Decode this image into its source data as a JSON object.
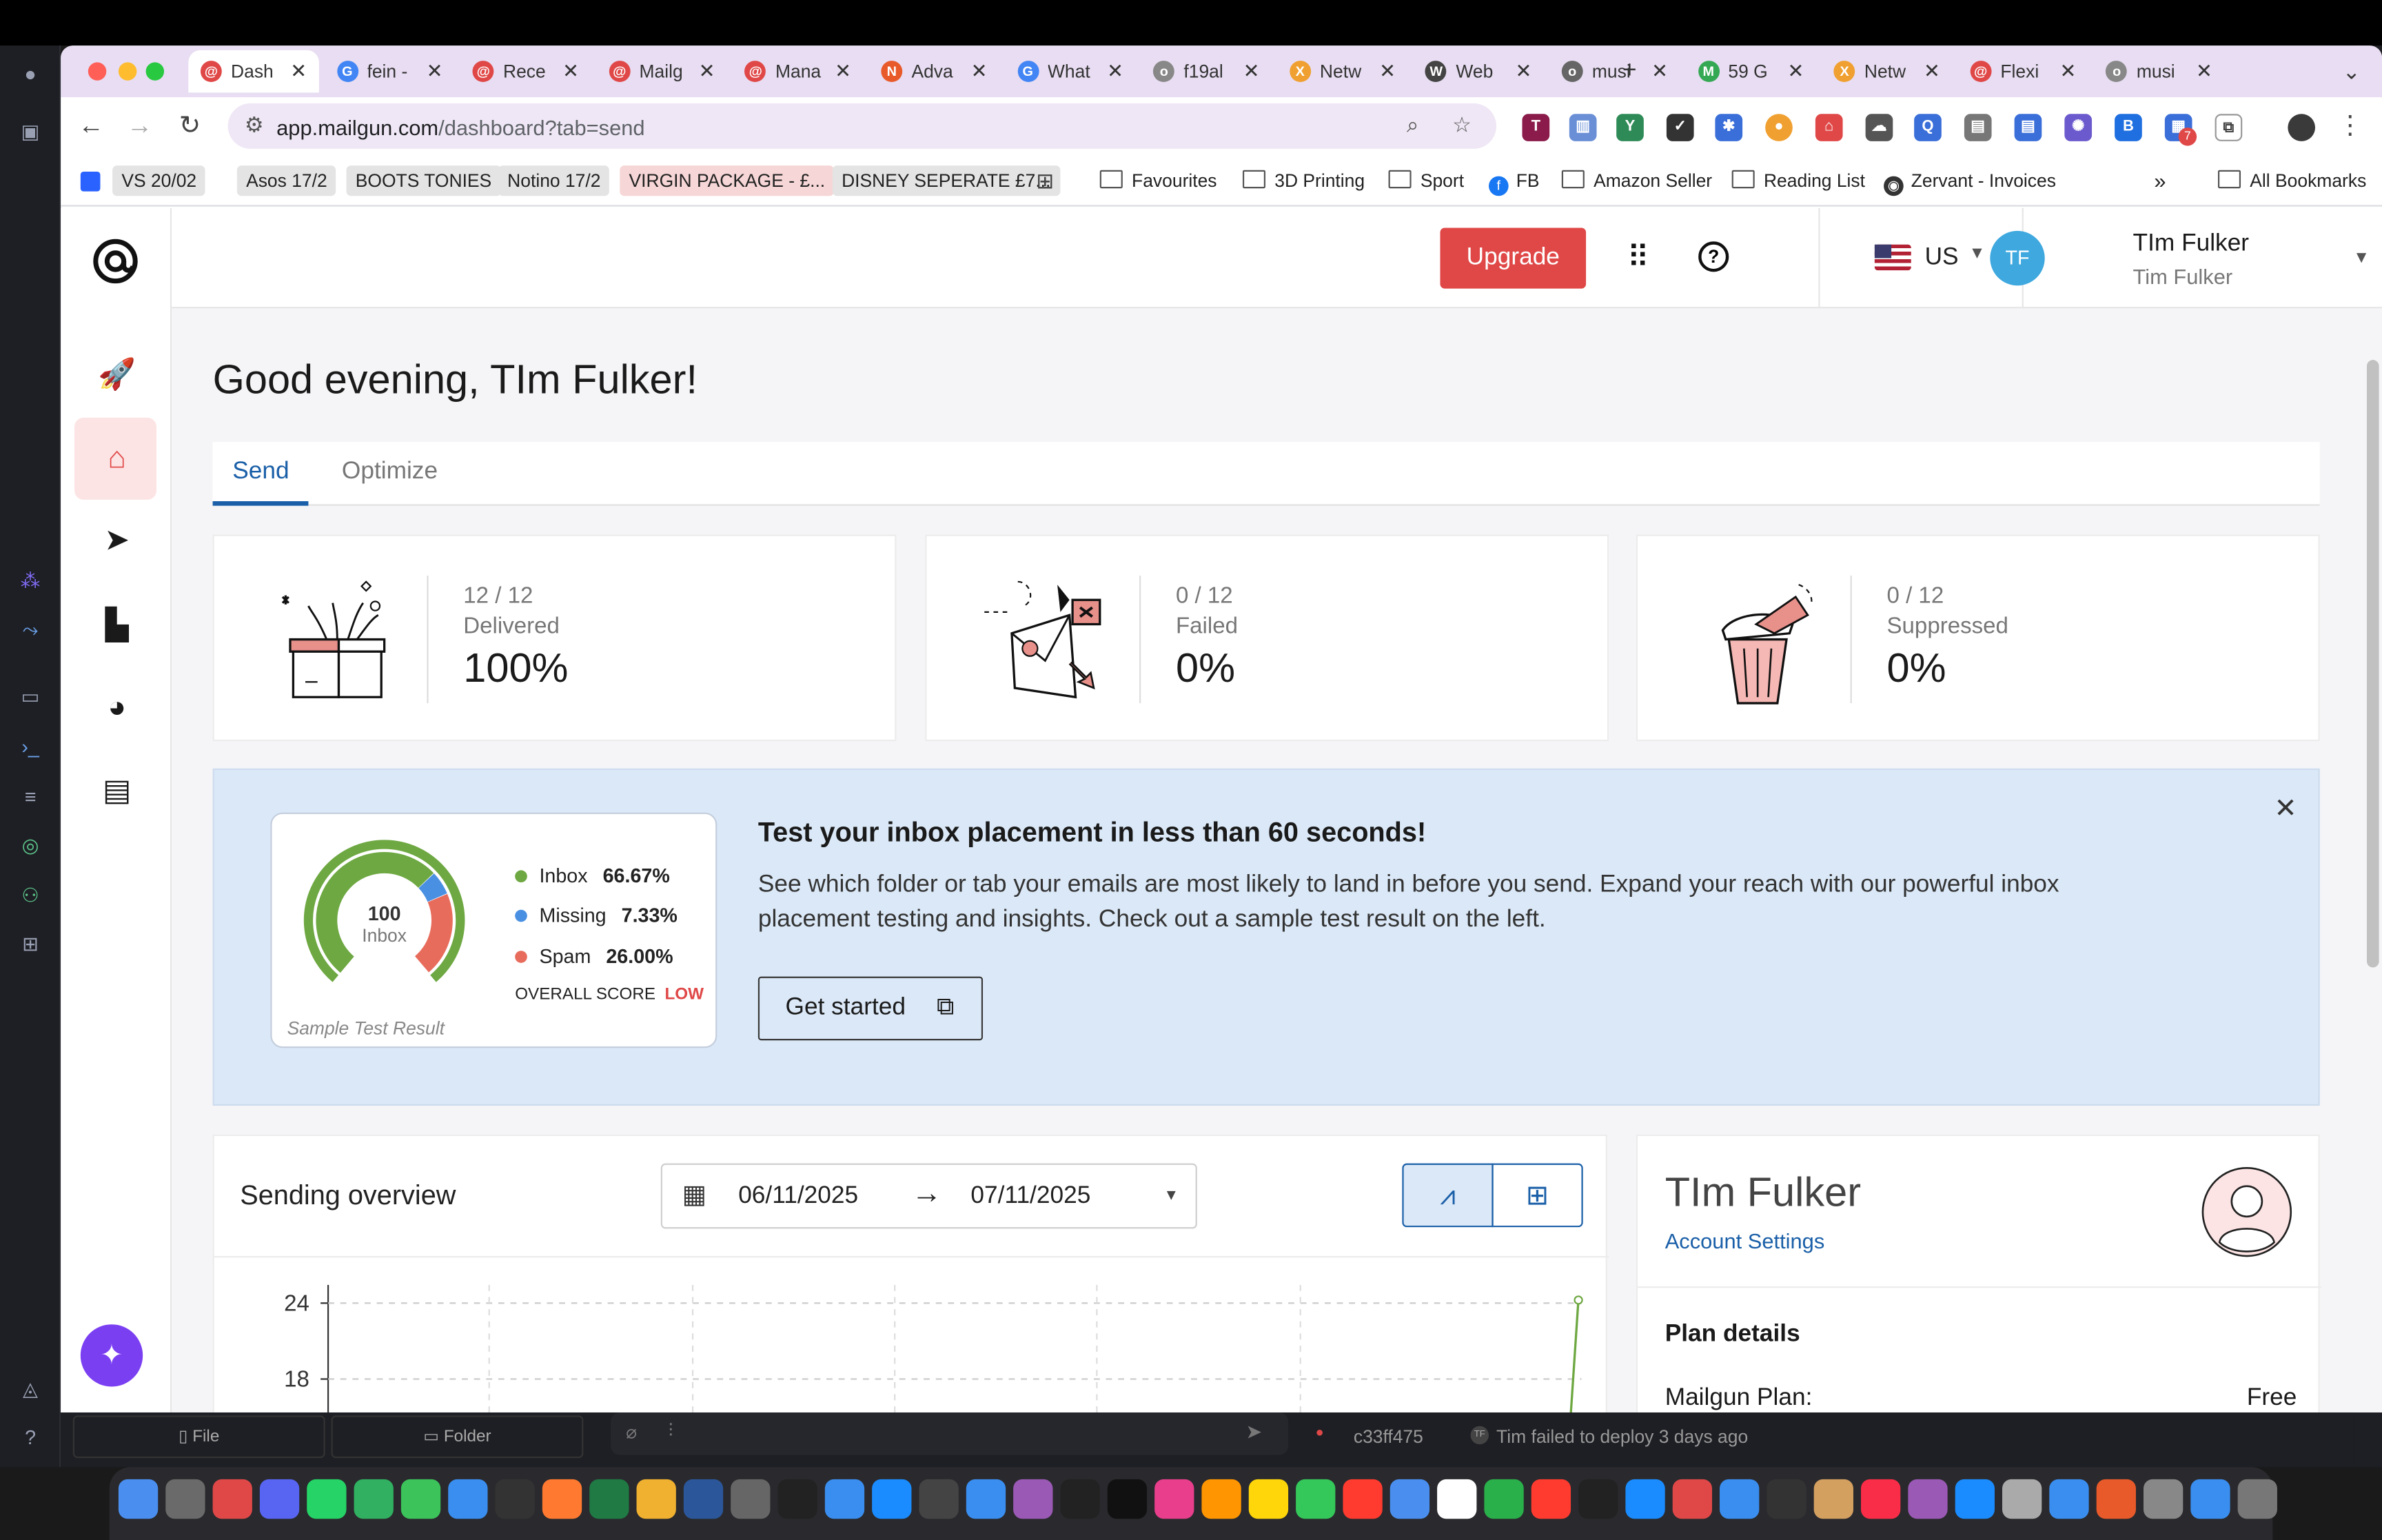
{
  "browser": {
    "tabs": [
      {
        "label": "Dash",
        "active": true,
        "color": "#e04848",
        "glyph": "@"
      },
      {
        "label": "fein -",
        "color": "#4285f4",
        "glyph": "G"
      },
      {
        "label": "Rece",
        "color": "#e04848",
        "glyph": "@"
      },
      {
        "label": "Mailg",
        "color": "#e04848",
        "glyph": "@"
      },
      {
        "label": "Mana",
        "color": "#e04848",
        "glyph": "@"
      },
      {
        "label": "Adva",
        "color": "#e85a2a",
        "glyph": "N"
      },
      {
        "label": "What",
        "color": "#4285f4",
        "glyph": "G"
      },
      {
        "label": "f19al",
        "color": "#888888",
        "glyph": "o"
      },
      {
        "label": "Netw",
        "color": "#f0a030",
        "glyph": "X"
      },
      {
        "label": "Web",
        "color": "#444444",
        "glyph": "W"
      },
      {
        "label": "musi",
        "color": "#666666",
        "glyph": "o"
      },
      {
        "label": "59 G",
        "color": "#34a853",
        "glyph": "M"
      },
      {
        "label": "Netw",
        "color": "#f0a030",
        "glyph": "X"
      },
      {
        "label": "Flexi",
        "color": "#e04848",
        "glyph": "@"
      },
      {
        "label": "musi",
        "color": "#888888",
        "glyph": "o"
      }
    ],
    "new_tab": "+",
    "url_host": "app.mailgun.com",
    "url_path": "/dashboard?tab=send",
    "bookmarks": [
      {
        "label": "VS 20/02",
        "bg": "#e4e4e4"
      },
      {
        "label": "Asos 17/2",
        "bg": "#e4e4e4"
      },
      {
        "label": "BOOTS TONIES",
        "bg": "#e4e4e4"
      },
      {
        "label": "Notino 17/2",
        "bg": "#e4e4e4"
      },
      {
        "label": "VIRGIN PACKAGE - £...",
        "bg": "#f6d6d6"
      },
      {
        "label": "DISNEY SEPERATE £7...",
        "bg": "#e4e4e4"
      }
    ],
    "bookmark_folders": [
      "Favourites",
      "3D Printing",
      "Sport"
    ],
    "bookmark_links": [
      "FB",
      "Amazon Seller",
      "Reading List",
      "Zervant - Invoices"
    ],
    "more": "»",
    "all_bookmarks": "All Bookmarks",
    "extension_badge": "7"
  },
  "header": {
    "upgrade": "Upgrade",
    "region": "US",
    "user_name": "TIm Fulker",
    "user_sub": "Tim Fulker",
    "avatar": "TF"
  },
  "main": {
    "greeting": "Good evening, TIm Fulker!",
    "tabs": [
      "Send",
      "Optimize"
    ],
    "stats": [
      {
        "fraction": "12 / 12",
        "label": "Delivered",
        "percent": "100%"
      },
      {
        "fraction": "0 / 12",
        "label": "Failed",
        "percent": "0%"
      },
      {
        "fraction": "0 / 12",
        "label": "Suppressed",
        "percent": "0%"
      }
    ],
    "banner": {
      "score_value": "100",
      "score_label": "Inbox",
      "legend": [
        {
          "label": "Inbox",
          "value": "66.67%",
          "color": "#6ea842",
          "pct": 66.67
        },
        {
          "label": "Missing",
          "value": "7.33%",
          "color": "#4a90e2",
          "pct": 7.33
        },
        {
          "label": "Spam",
          "value": "26.00%",
          "color": "#e86c5c",
          "pct": 26.0
        }
      ],
      "overall_label": "OVERALL SCORE",
      "overall_value": "LOW",
      "sample": "Sample Test Result",
      "title": "Test your inbox placement in less than 60 seconds!",
      "description": "See which folder or tab your emails are most likely to land in before you send. Expand your reach with our powerful inbox placement testing and insights. Check out a sample test result on the left.",
      "cta": "Get started"
    },
    "overview": {
      "title": "Sending overview",
      "date_from": "06/11/2025",
      "date_to": "07/11/2025",
      "y_ticks": [
        "24",
        "18"
      ]
    },
    "profile": {
      "name": "TIm Fulker",
      "link": "Account Settings",
      "plan_title": "Plan details",
      "plan_label": "Mailgun Plan:",
      "plan_value": "Free"
    }
  },
  "under": {
    "file": "File",
    "folder": "Folder",
    "commit": "c33ff475",
    "deploy": "Tim failed to deploy 3 days ago"
  }
}
